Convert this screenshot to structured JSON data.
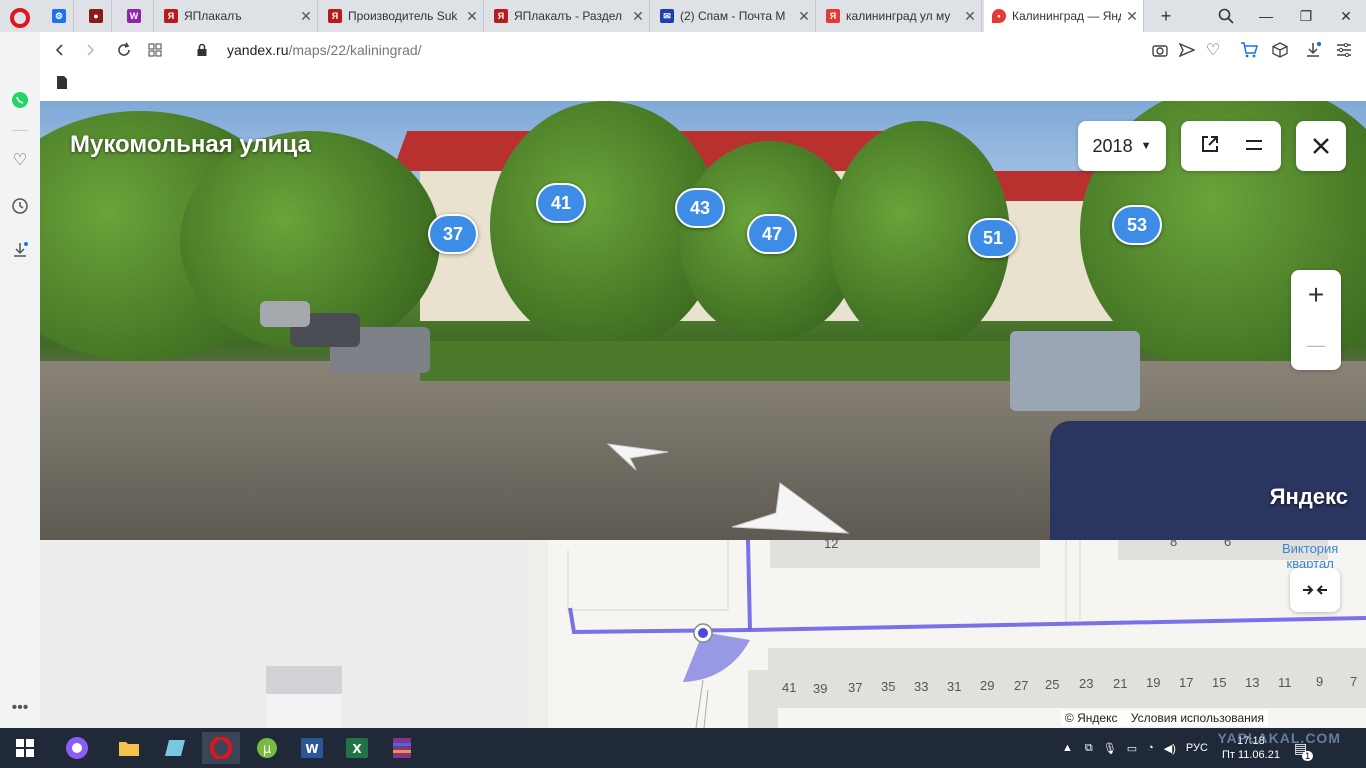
{
  "browser": {
    "tabs": [
      {
        "title": "",
        "favicon_color": "#1a73e8"
      },
      {
        "title": "",
        "favicon_color": "#8b1a1a"
      },
      {
        "title": "",
        "favicon_color": "#8e24aa"
      },
      {
        "title": "ЯПлакалъ",
        "favicon_color": "#b71c1c"
      },
      {
        "title": "Производитель Suk",
        "favicon_color": "#b71c1c"
      },
      {
        "title": "ЯПлакалъ - Раздел",
        "favicon_color": "#b71c1c"
      },
      {
        "title": "(2) Спам - Почта М",
        "favicon_color": "#1e40af"
      },
      {
        "title": "калининград ул му",
        "favicon_color": "#e53935"
      },
      {
        "title": "Калининград — Янд",
        "favicon_color": "#e53935"
      }
    ],
    "new_tab_label": "+",
    "url_host": "yandex.ru",
    "url_path": "/maps/22/kaliningrad/",
    "window_controls": {
      "minimize": "—",
      "maximize": "❐",
      "close": "✕"
    }
  },
  "panorama": {
    "street_title": "Мукомольная улица",
    "year": "2018",
    "house_numbers": [
      "37",
      "41",
      "43",
      "47",
      "51",
      "53"
    ],
    "brand": "Яндекс",
    "zoom_in": "+",
    "zoom_out": "—"
  },
  "map": {
    "district_label_line1": "Виктория",
    "district_label_line2": "квартал",
    "house_numbers_row": [
      "41",
      "39",
      "37",
      "35",
      "33",
      "31",
      "29",
      "27",
      "25",
      "23",
      "21",
      "19",
      "17",
      "15",
      "13",
      "11",
      "9",
      "7"
    ],
    "top_number": "12",
    "top_numbers_right": [
      "8",
      "6"
    ],
    "footer_copyright": "© Яндекс",
    "footer_terms": "Условия использования"
  },
  "taskbar": {
    "language": "РУС",
    "time": "17:18",
    "date": "Пт 11.06.21",
    "notifications_count": "1"
  },
  "watermark": "YAPLAKAL.COM"
}
